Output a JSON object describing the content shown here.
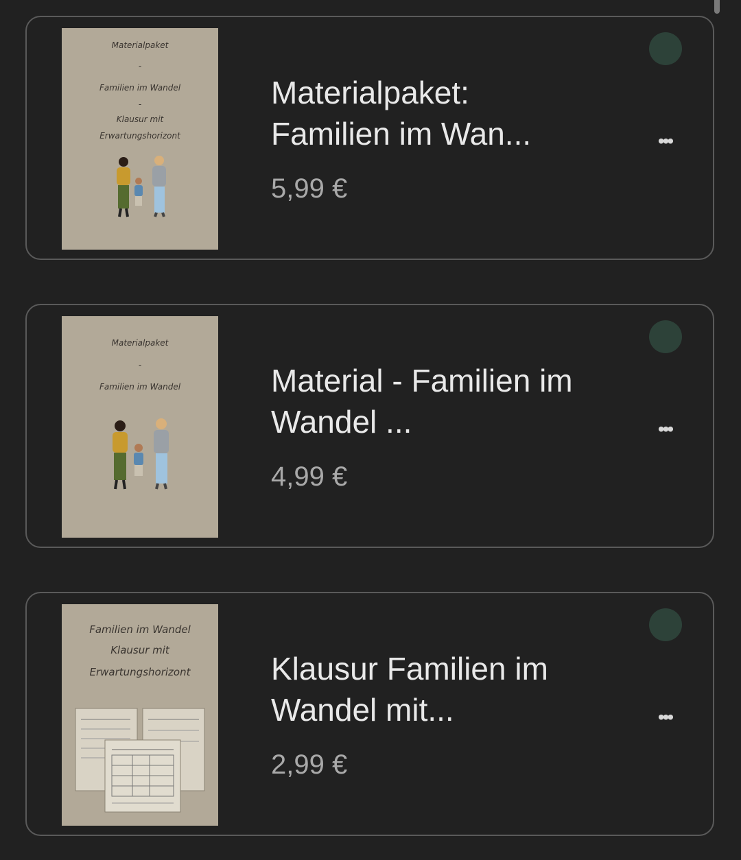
{
  "colors": {
    "background": "#212121",
    "card_border": "#5a5a5a",
    "title_text": "#e9e9e9",
    "price_text": "#a9a9a9",
    "status_dot": "#2d4239",
    "cover_paper": "#b2a998"
  },
  "icons": {
    "more": "more-horizontal-icon",
    "more_glyph": "•••"
  },
  "products": [
    {
      "title_line1": "Materialpaket:",
      "title_line2": "Familien im Wan...",
      "price": "5,99 €",
      "cover": {
        "lines": [
          "Materialpaket",
          "-",
          "Familien im Wandel",
          "-",
          "Klausur mit",
          "Erwartungshorizont"
        ],
        "illustration": "family-illustration"
      }
    },
    {
      "title_line1": "Material - Familien im",
      "title_line2": "Wandel ...",
      "price": "4,99 €",
      "cover": {
        "lines": [
          "Materialpaket",
          "-",
          "Familien im Wandel"
        ],
        "illustration": "family-illustration"
      }
    },
    {
      "title_line1": "Klausur Familien im",
      "title_line2": "Wandel mit...",
      "price": "2,99 €",
      "cover": {
        "lines": [
          "Familien im Wandel",
          "Klausur mit",
          "Erwartungshorizont"
        ],
        "illustration": "worksheet-illustration"
      }
    }
  ]
}
